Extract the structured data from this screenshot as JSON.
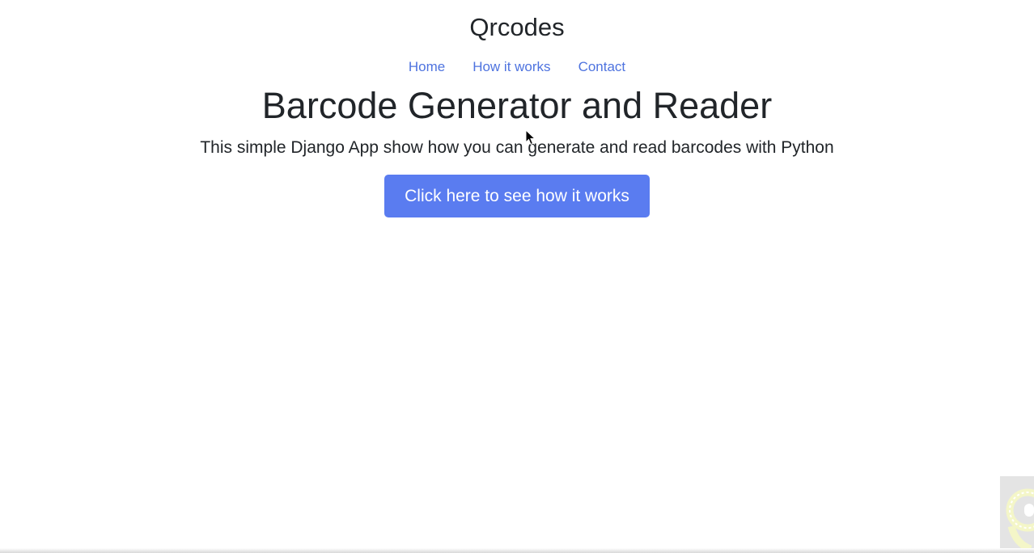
{
  "header": {
    "brand": "Qrcodes",
    "nav": [
      {
        "label": "Home"
      },
      {
        "label": "How it works"
      },
      {
        "label": "Contact"
      }
    ]
  },
  "hero": {
    "title": "Barcode Generator and Reader",
    "subtitle": "This simple Django App show how you can generate and read barcodes with Python",
    "cta_label": "Click here to see how it works"
  },
  "colors": {
    "accent": "#5a7cf0",
    "link": "#4e73df",
    "text": "#212529"
  },
  "icons": {
    "cursor": "mouse-pointer-icon",
    "corner": "widget-icon"
  }
}
